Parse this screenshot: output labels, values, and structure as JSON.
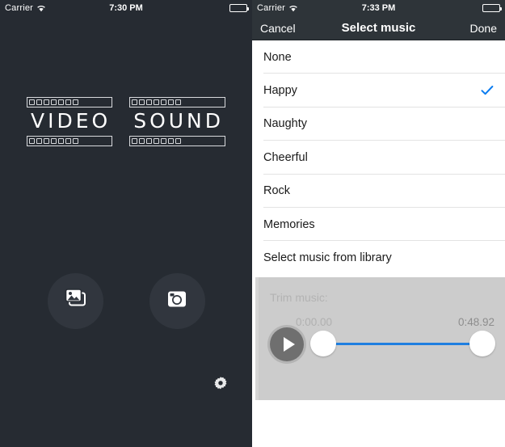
{
  "left_panel": {
    "status_bar": {
      "carrier": "Carrier",
      "wifi_icon": "wifi-icon",
      "time": "7:30 PM",
      "battery_icon": "battery-icon"
    },
    "logo": {
      "word1": "VIDEO",
      "word2": "SOUND"
    },
    "buttons": {
      "library_icon": "photo-library-icon",
      "camera_icon": "camera-icon",
      "settings_icon": "gear-icon"
    },
    "background_color": "#262b32",
    "circle_color": "#31363e"
  },
  "right_panel": {
    "status_bar": {
      "carrier": "Carrier",
      "wifi_icon": "wifi-icon",
      "time": "7:33 PM",
      "battery_icon": "battery-icon"
    },
    "navbar": {
      "cancel_label": "Cancel",
      "title": "Select music",
      "done_label": "Done",
      "background_color": "#2e3439"
    },
    "music_options": [
      {
        "label": "None",
        "selected": false
      },
      {
        "label": "Happy",
        "selected": true
      },
      {
        "label": "Naughty",
        "selected": false
      },
      {
        "label": "Cheerful",
        "selected": false
      },
      {
        "label": "Rock",
        "selected": false
      },
      {
        "label": "Memories",
        "selected": false
      },
      {
        "label": "Select music from library",
        "selected": false
      }
    ],
    "checkmark_color": "#0a7cf0",
    "trim": {
      "title": "Trim music:",
      "start_time": "0:00.00",
      "end_time": "0:48.92",
      "play_icon": "play-icon",
      "slider_track_color": "#1f7fe0",
      "panel_color": "#cccccc"
    }
  }
}
